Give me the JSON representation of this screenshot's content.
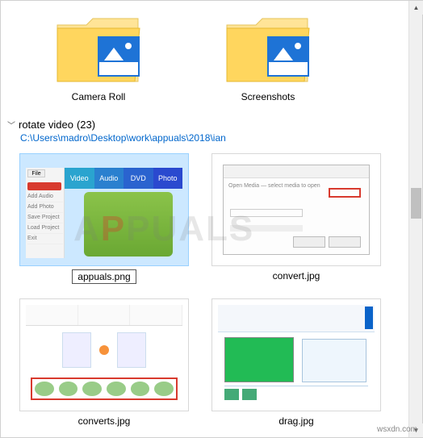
{
  "folders": [
    {
      "label": "Camera Roll"
    },
    {
      "label": "Screenshots"
    }
  ],
  "group": {
    "name": "rotate video",
    "count": "(23)",
    "path": "C:\\Users\\madro\\Desktop\\work\\appuals\\2018\\ian"
  },
  "files": [
    {
      "label": "appuals.png",
      "selected": true
    },
    {
      "label": "convert.jpg",
      "selected": false
    },
    {
      "label": "converts.jpg",
      "selected": false
    },
    {
      "label": "drag.jpg",
      "selected": false
    }
  ],
  "watermark": {
    "pre": "A",
    "mid": "P",
    "post": "PUALS"
  },
  "attribution": "wsxdn.com"
}
